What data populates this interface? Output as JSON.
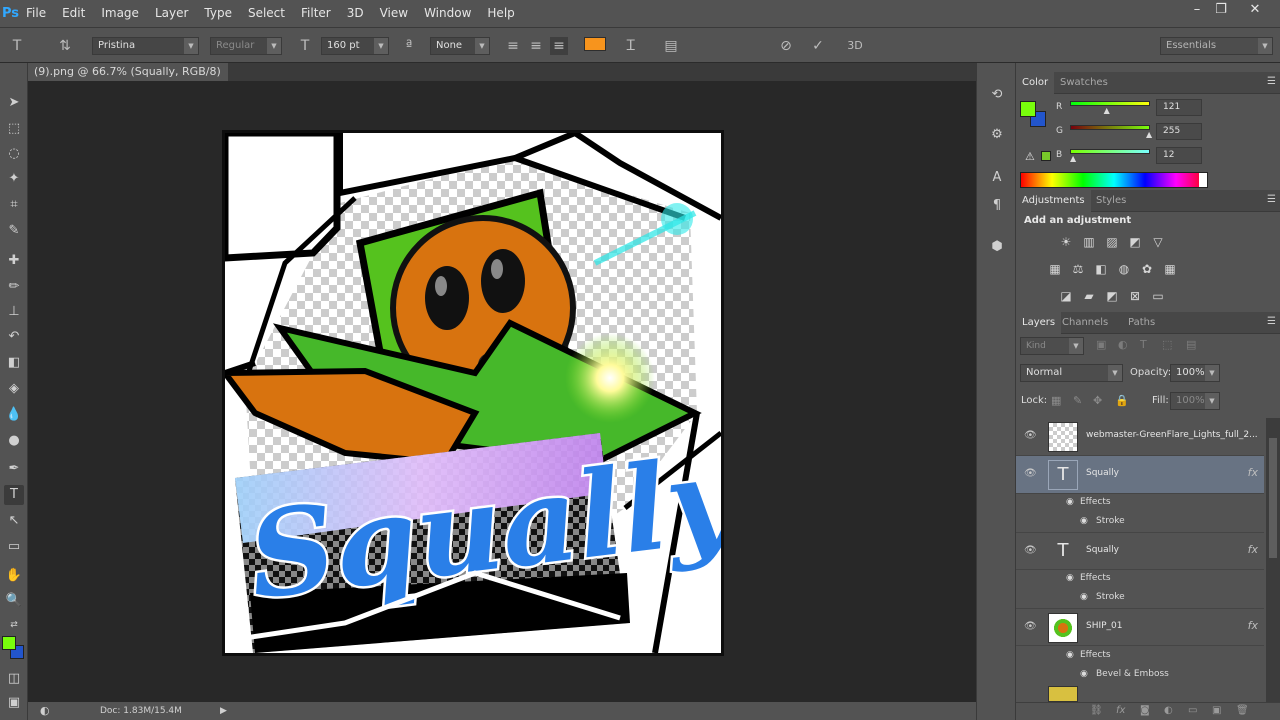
{
  "app": {
    "logo": "Ps"
  },
  "menu": [
    "File",
    "Edit",
    "Image",
    "Layer",
    "Type",
    "Select",
    "Filter",
    "3D",
    "View",
    "Window",
    "Help"
  ],
  "window_controls": {
    "minimize": "–",
    "restore": "❐",
    "close": "✕"
  },
  "options_bar": {
    "font_family": "Pristina",
    "font_style": "Regular",
    "font_size": "160 pt",
    "antialias": "None",
    "text_color": "#f7941d",
    "workspace": "Essentials"
  },
  "document": {
    "tab_title": "(9).png @ 66.7% (Squally, RGB/8) *",
    "tab_close": "×",
    "artwork_text": "Squally",
    "status": "Doc: 1.83M/15.4M"
  },
  "toolbar": {
    "foreground_color": "#79ff0c",
    "background_color": "#2255cc"
  },
  "color_panel": {
    "tabs": [
      "Color",
      "Swatches"
    ],
    "r_label": "R",
    "g_label": "G",
    "b_label": "B",
    "r": "121",
    "g": "255",
    "b": "12",
    "r_fraction": 0.47,
    "g_fraction": 1.0,
    "b_fraction": 0.05
  },
  "adjustments_panel": {
    "tabs": [
      "Adjustments",
      "Styles"
    ],
    "heading": "Add an adjustment"
  },
  "layers_panel": {
    "tabs": [
      "Layers",
      "Channels",
      "Paths"
    ],
    "filter_kind": "Kind",
    "blend_mode": "Normal",
    "opacity_label": "Opacity:",
    "opacity": "100%",
    "lock_label": "Lock:",
    "fill_label": "Fill:",
    "fill": "100%",
    "layers": [
      {
        "name": "webmaster-GreenFlare_Lights_full_2...",
        "selected": false,
        "fx": ""
      },
      {
        "name": "Squally",
        "selected": true,
        "fx": "fx"
      },
      {
        "name": "Squally",
        "selected": false,
        "fx": "fx"
      },
      {
        "name": "SHIP_01",
        "selected": false,
        "fx": "fx"
      }
    ],
    "effects_label": "Effects",
    "stroke_label": "Stroke",
    "bevel_label": "Bevel & Emboss"
  }
}
